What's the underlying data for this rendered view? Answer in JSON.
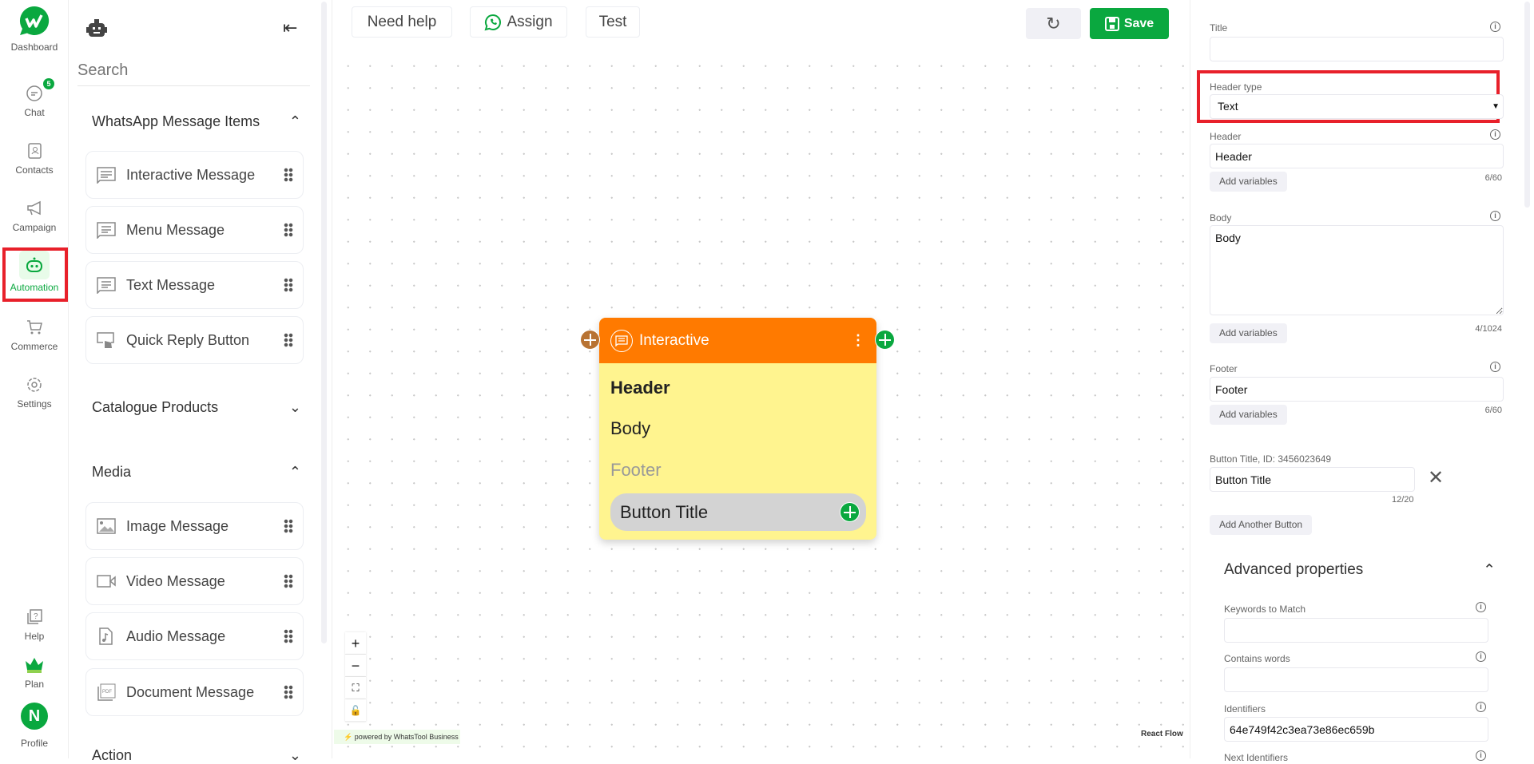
{
  "rail": {
    "items": [
      {
        "label": "Dashboard"
      },
      {
        "label": "Chat",
        "badge": "5"
      },
      {
        "label": "Contacts"
      },
      {
        "label": "Campaign"
      },
      {
        "label": "Automation",
        "active": true
      },
      {
        "label": "Commerce"
      },
      {
        "label": "Settings"
      },
      {
        "label": "Help"
      },
      {
        "label": "Plan"
      },
      {
        "label": "Profile",
        "avatar": "N"
      }
    ]
  },
  "sidebar": {
    "search_placeholder": "Search",
    "sections": [
      {
        "title": "WhatsApp Message Items",
        "expanded": true,
        "items": [
          "Interactive Message",
          "Menu Message",
          "Text Message",
          "Quick Reply Button"
        ]
      },
      {
        "title": "Catalogue Products",
        "expanded": false
      },
      {
        "title": "Media",
        "expanded": true,
        "items": [
          "Image Message",
          "Video Message",
          "Audio Message",
          "Document Message"
        ]
      },
      {
        "title": "Action",
        "expanded": false
      }
    ]
  },
  "toolbar": {
    "need_help": "Need help",
    "assign": "Assign",
    "test": "Test",
    "save": "Save"
  },
  "node": {
    "type": "Interactive",
    "header": "Header",
    "body": "Body",
    "footer": "Footer",
    "button": "Button Title"
  },
  "canvas": {
    "powered_by": "powered by WhatsTool Business",
    "attribution": "React Flow"
  },
  "panel": {
    "title_label": "Title",
    "title_value": "",
    "header_type_label": "Header type",
    "header_type_value": "Text",
    "header_label": "Header",
    "header_value": "Header",
    "header_count": "6/60",
    "body_label": "Body",
    "body_value": "Body",
    "body_count": "4/1024",
    "footer_label": "Footer",
    "footer_value": "Footer",
    "footer_count": "6/60",
    "add_variables": "Add variables",
    "button_label": "Button Title, ID: 3456023649",
    "button_value": "Button Title",
    "button_count": "12/20",
    "add_another": "Add Another Button",
    "advanced": "Advanced properties",
    "keywords_label": "Keywords to Match",
    "contains_label": "Contains words",
    "identifiers_label": "Identifiers",
    "identifiers_value": "64e749f42c3ea73e86ec659b",
    "next_label": "Next Identifiers"
  },
  "colors": {
    "brand": "#0aa83f",
    "node_header": "#ff7a00",
    "node_body": "#fff48f",
    "highlight": "#e8202a"
  }
}
